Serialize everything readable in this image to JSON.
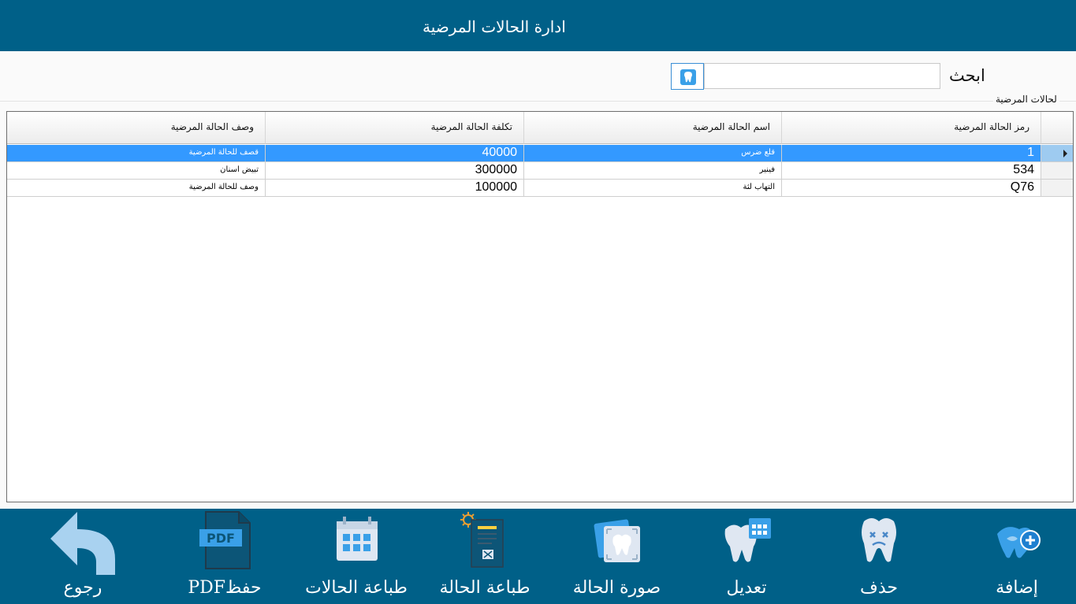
{
  "window": {
    "title": "ادارة الحالات المرضية"
  },
  "search": {
    "label": "ابحث",
    "value": "",
    "placeholder": ""
  },
  "group_label": "لحالات المرضية",
  "table": {
    "columns": [
      "رمز الحالة المرضية",
      "اسم الحالة المرضية",
      "تكلفة الحالة المرضية",
      "وصف الحالة المرضية"
    ],
    "rows": [
      {
        "code": "1",
        "name": "قلع ضرس",
        "cost": "40000",
        "description": "قصف للحالة المرضية",
        "selected": true
      },
      {
        "code": "534",
        "name": "فينير",
        "cost": "300000",
        "description": "تبيض اسنان",
        "selected": false
      },
      {
        "code": "Q76",
        "name": "التهاب لثة",
        "cost": "100000",
        "description": "وصف للحالة المرضية",
        "selected": false
      }
    ]
  },
  "toolbar": {
    "add": "إضافة",
    "delete": "حذف",
    "edit": "تعديل",
    "case_image": "صورة الحالة",
    "print_case": "طباعة الحالة",
    "print_cases": "طباعة الحالات",
    "save_pdf": "حفظPDF",
    "pdf_icon_text": "PDF",
    "back": "رجوع"
  },
  "colors": {
    "header_bg": "#006088",
    "selection": "#3399ff",
    "icon_blue": "#3aa0e8"
  }
}
